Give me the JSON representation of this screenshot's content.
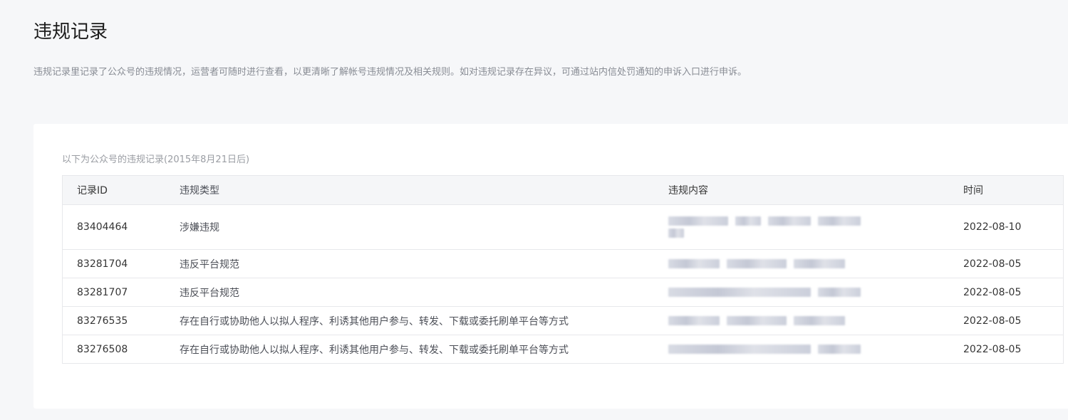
{
  "page": {
    "title": "违规记录",
    "description": "违规记录里记录了公众号的违规情况，运营者可随时进行查看，以更清晰了解帐号违规情况及相关规则。如对违规记录存在异议，可通过站内信处罚通知的申诉入口进行申诉。"
  },
  "records": {
    "caption": "以下为公众号的违规记录(2015年8月21日后)",
    "columns": [
      "记录ID",
      "违规类型",
      "违规内容",
      "时间"
    ],
    "rows": [
      {
        "id": "83404464",
        "type": "涉嫌违规",
        "content": "(已模糊处理)",
        "time": "2022-08-10"
      },
      {
        "id": "83281704",
        "type": "违反平台规范",
        "content": "(已模糊处理)",
        "time": "2022-08-05"
      },
      {
        "id": "83281707",
        "type": "违反平台规范",
        "content": "(已模糊处理)",
        "time": "2022-08-05"
      },
      {
        "id": "83276535",
        "type": "存在自行或协助他人以拟人程序、利诱其他用户参与、转发、下载或委托刷单平台等方式",
        "content": "(已模糊处理)",
        "time": "2022-08-05"
      },
      {
        "id": "83276508",
        "type": "存在自行或协助他人以拟人程序、利诱其他用户参与、转发、下载或委托刷单平台等方式",
        "content": "(已模糊处理)",
        "time": "2022-08-05"
      }
    ]
  },
  "colors": {
    "page_bg": "#f6f7f9",
    "card_bg": "#ffffff",
    "header_bg": "#f5f6f8",
    "border": "#e7e8eb",
    "muted_text": "#888c94"
  }
}
